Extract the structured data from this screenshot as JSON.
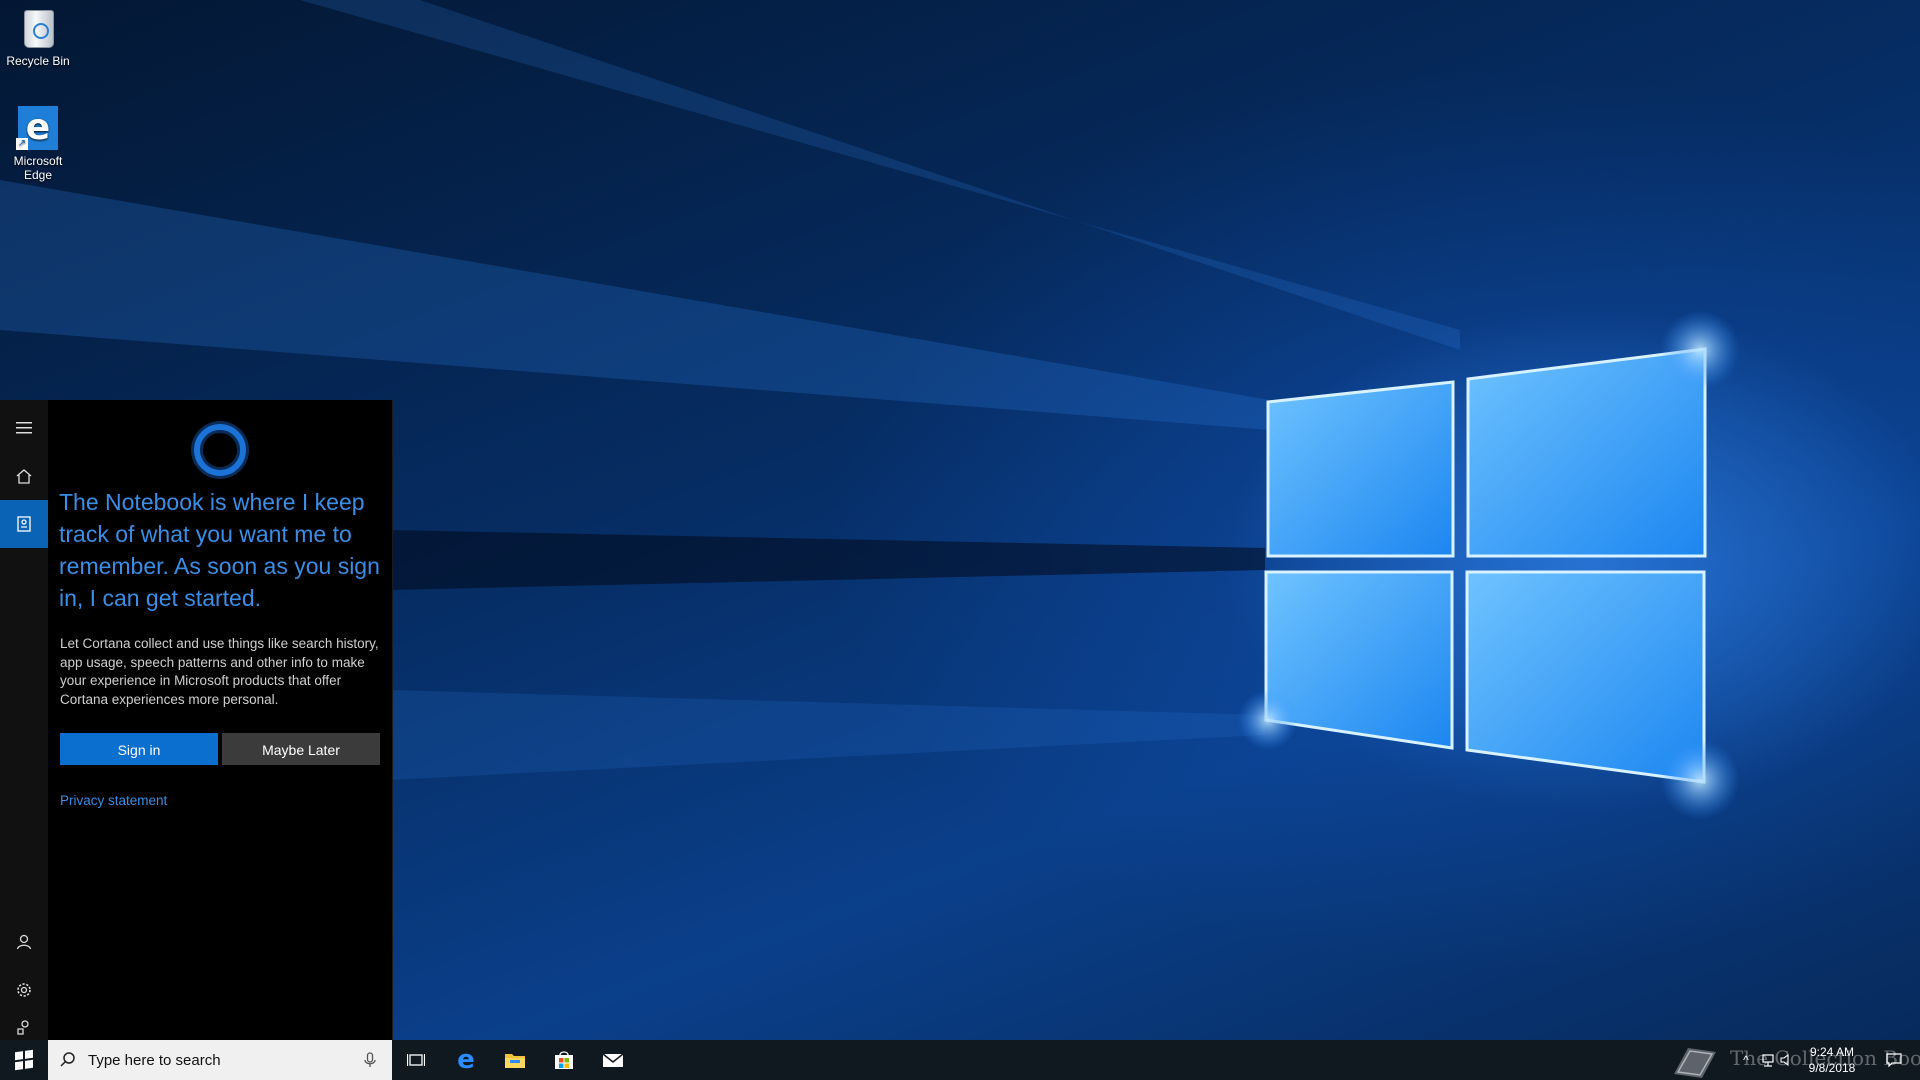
{
  "desktop": {
    "icons": [
      {
        "label": "Recycle Bin",
        "icon": "recycle-bin-icon"
      },
      {
        "label": "Microsoft\nEdge",
        "icon": "edge-icon"
      }
    ]
  },
  "cortana": {
    "rail": [
      "menu-icon",
      "home-icon",
      "notebook-icon",
      "account-icon",
      "settings-icon",
      "feedback-icon"
    ],
    "active_rail_item": "notebook",
    "title": "The Notebook is where I keep track of what you want me to remember. As soon as you sign in, I can get started.",
    "description": "Let Cortana collect and use things like search history, app usage, speech patterns and other info to make your experience in Microsoft products that offer Cortana experiences more personal.",
    "signin_label": "Sign in",
    "later_label": "Maybe Later",
    "privacy_label": "Privacy statement",
    "accent": "#0b6fd0",
    "text_accent": "#3a8ee6"
  },
  "taskbar": {
    "search_placeholder": "Type here to search",
    "apps": [
      "task-view-icon",
      "edge-icon",
      "file-explorer-icon",
      "store-icon",
      "mail-icon"
    ],
    "time": "9:24 AM",
    "date": "9/8/2018",
    "watermark": "The Collection Book"
  }
}
